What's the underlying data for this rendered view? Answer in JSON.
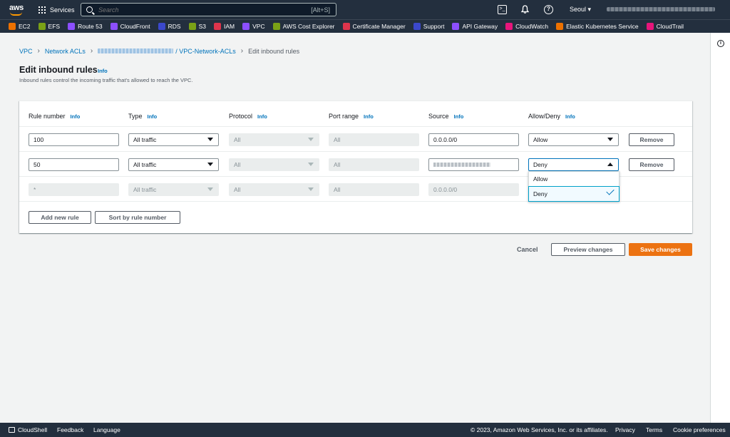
{
  "nav": {
    "services_label": "Services",
    "search_placeholder": "Search",
    "search_shortcut": "[Alt+S]",
    "region": "Seoul ▾"
  },
  "favorites": [
    {
      "label": "EC2",
      "color": "#ed7100"
    },
    {
      "label": "EFS",
      "color": "#7aa116"
    },
    {
      "label": "Route 53",
      "color": "#8c4fff"
    },
    {
      "label": "CloudFront",
      "color": "#8c4fff"
    },
    {
      "label": "RDS",
      "color": "#3b48cc"
    },
    {
      "label": "S3",
      "color": "#7aa116"
    },
    {
      "label": "IAM",
      "color": "#dd344c"
    },
    {
      "label": "VPC",
      "color": "#8c4fff"
    },
    {
      "label": "AWS Cost Explorer",
      "color": "#7aa116"
    },
    {
      "label": "Certificate Manager",
      "color": "#dd344c"
    },
    {
      "label": "Support",
      "color": "#3b48cc"
    },
    {
      "label": "API Gateway",
      "color": "#8c4fff"
    },
    {
      "label": "CloudWatch",
      "color": "#e7157b"
    },
    {
      "label": "Elastic Kubernetes Service",
      "color": "#ed7100"
    },
    {
      "label": "CloudTrail",
      "color": "#e7157b"
    }
  ],
  "breadcrumb": {
    "vpc": "VPC",
    "network_acls": "Network ACLs",
    "acl_name": "/ VPC-Network-ACLs",
    "current": "Edit inbound rules"
  },
  "page": {
    "title": "Edit inbound rules",
    "info": "Info",
    "subtitle": "Inbound rules control the incoming traffic that's allowed to reach the VPC."
  },
  "columns": {
    "rule_number": "Rule number",
    "type": "Type",
    "protocol": "Protocol",
    "port_range": "Port range",
    "source": "Source",
    "allow_deny": "Allow/Deny",
    "info": "Info"
  },
  "rows": [
    {
      "rule_number": "100",
      "type": "All traffic",
      "protocol": "All",
      "port_range": "All",
      "source": "0.0.0.0/0",
      "action": "Allow",
      "remove": "Remove"
    },
    {
      "rule_number": "50",
      "type": "All traffic",
      "protocol": "All",
      "port_range": "All",
      "source": "",
      "action": "Deny",
      "remove": "Remove"
    },
    {
      "rule_number": "*",
      "type": "All traffic",
      "protocol": "All",
      "port_range": "All",
      "source": "0.0.0.0/0",
      "action": "",
      "remove": ""
    }
  ],
  "dropdown": {
    "options": [
      "Allow",
      "Deny"
    ],
    "selected": "Deny"
  },
  "buttons": {
    "add_rule": "Add new rule",
    "sort": "Sort by rule number",
    "cancel": "Cancel",
    "preview": "Preview changes",
    "save": "Save changes"
  },
  "footer": {
    "cloudshell": "CloudShell",
    "feedback": "Feedback",
    "language": "Language",
    "copyright": "© 2023, Amazon Web Services, Inc. or its affiliates.",
    "privacy": "Privacy",
    "terms": "Terms",
    "cookies": "Cookie preferences"
  }
}
